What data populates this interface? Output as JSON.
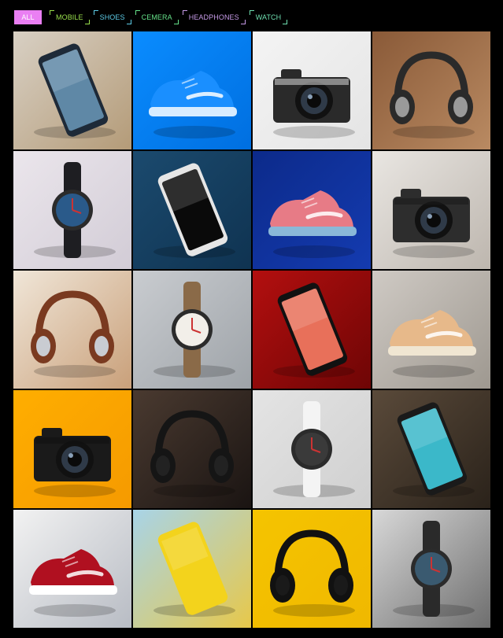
{
  "filters": [
    {
      "label": "ALL",
      "active": true,
      "color": "#ffffff",
      "bg": "#ea7ff3"
    },
    {
      "label": "MOBILE",
      "active": false,
      "color": "#9be24d"
    },
    {
      "label": "SHOES",
      "active": false,
      "color": "#5ecde8"
    },
    {
      "label": "CEMERA",
      "active": false,
      "color": "#66e38a"
    },
    {
      "label": "HEADPHONES",
      "active": false,
      "color": "#c79be8"
    },
    {
      "label": "WATCH",
      "active": false,
      "color": "#6fe0b1"
    }
  ],
  "gallery": [
    {
      "type": "phone",
      "category": "MOBILE",
      "bg": [
        "#d8d0c4",
        "#b49b78"
      ],
      "accent": "#1e2a38",
      "screen": "#5f88a6"
    },
    {
      "type": "shoe",
      "category": "SHOES",
      "bg": [
        "#0a8cff",
        "#006fe0"
      ],
      "accent": "#1a8fff",
      "sole": "#d8ecff"
    },
    {
      "type": "camera",
      "category": "CEMERA",
      "bg": [
        "#f4f4f4",
        "#e4e4e4"
      ],
      "accent": "#c9c9c9",
      "body": "#2a2a2a"
    },
    {
      "type": "headphones",
      "category": "HEADPHONES",
      "bg": [
        "#8a5a38",
        "#b98a62"
      ],
      "accent": "#2a2a2a",
      "cup": "#9a9a9a"
    },
    {
      "type": "watch",
      "category": "WATCH",
      "bg": [
        "#ebe6ec",
        "#d2ccd6"
      ],
      "accent": "#1e1e22",
      "face": "#2a5a8a"
    },
    {
      "type": "phone",
      "category": "MOBILE",
      "bg": [
        "#1b4a6e",
        "#0f3351"
      ],
      "accent": "#e6e6e6",
      "screen": "#0a0a0a"
    },
    {
      "type": "shoe",
      "category": "SHOES",
      "bg": [
        "#0c2a8a",
        "#143bb0"
      ],
      "accent": "#e77b86",
      "sole": "#8ab8d8"
    },
    {
      "type": "camera",
      "category": "CEMERA",
      "bg": [
        "#e9e6e2",
        "#bdb6ae"
      ],
      "accent": "#1a1a1a",
      "body": "#2d2d2d"
    },
    {
      "type": "headphones",
      "category": "HEADPHONES",
      "bg": [
        "#f0e6d8",
        "#c9a07a"
      ],
      "accent": "#7a3a20",
      "cup": "#c9ccd2"
    },
    {
      "type": "watch",
      "category": "WATCH",
      "bg": [
        "#c9ccd0",
        "#9ea3a8"
      ],
      "accent": "#8a6a48",
      "face": "#f2efe9"
    },
    {
      "type": "phone",
      "category": "MOBILE",
      "bg": [
        "#b30f0f",
        "#6e0505"
      ],
      "accent": "#111111",
      "screen": "#e8705a"
    },
    {
      "type": "shoe",
      "category": "SHOES",
      "bg": [
        "#cfcac4",
        "#9e9890"
      ],
      "accent": "#e7b98a",
      "sole": "#f0e6d2"
    },
    {
      "type": "camera",
      "category": "CEMERA",
      "bg": [
        "#ffae00",
        "#f59a00"
      ],
      "accent": "#111111",
      "body": "#1a1a1a"
    },
    {
      "type": "headphones",
      "category": "HEADPHONES",
      "bg": [
        "#4a3a30",
        "#1a1412"
      ],
      "accent": "#151515",
      "cup": "#222222"
    },
    {
      "type": "watch",
      "category": "WATCH",
      "bg": [
        "#e4e4e4",
        "#cfcfcf"
      ],
      "accent": "#f4f4f4",
      "face": "#3a3a3a"
    },
    {
      "type": "phone",
      "category": "MOBILE",
      "bg": [
        "#5a4a3a",
        "#2a221a"
      ],
      "accent": "#1a1a1a",
      "screen": "#3bb8c9"
    },
    {
      "type": "shoe",
      "category": "SHOES",
      "bg": [
        "#f2f2f2",
        "#b8bcc4"
      ],
      "accent": "#b01020",
      "sole": "#ffffff"
    },
    {
      "type": "phone",
      "category": "MOBILE",
      "bg": [
        "#a8d4e8",
        "#e7c84a"
      ],
      "accent": "#f3d31c",
      "screen": "#f3d31c"
    },
    {
      "type": "headphones",
      "category": "HEADPHONES",
      "bg": [
        "#f5c400",
        "#f0b800"
      ],
      "accent": "#111111",
      "cup": "#1a1a1a"
    },
    {
      "type": "watch",
      "category": "WATCH",
      "bg": [
        "#d8d8d8",
        "#6e6e6e"
      ],
      "accent": "#2a2a2a",
      "face": "#3a5a70"
    }
  ]
}
